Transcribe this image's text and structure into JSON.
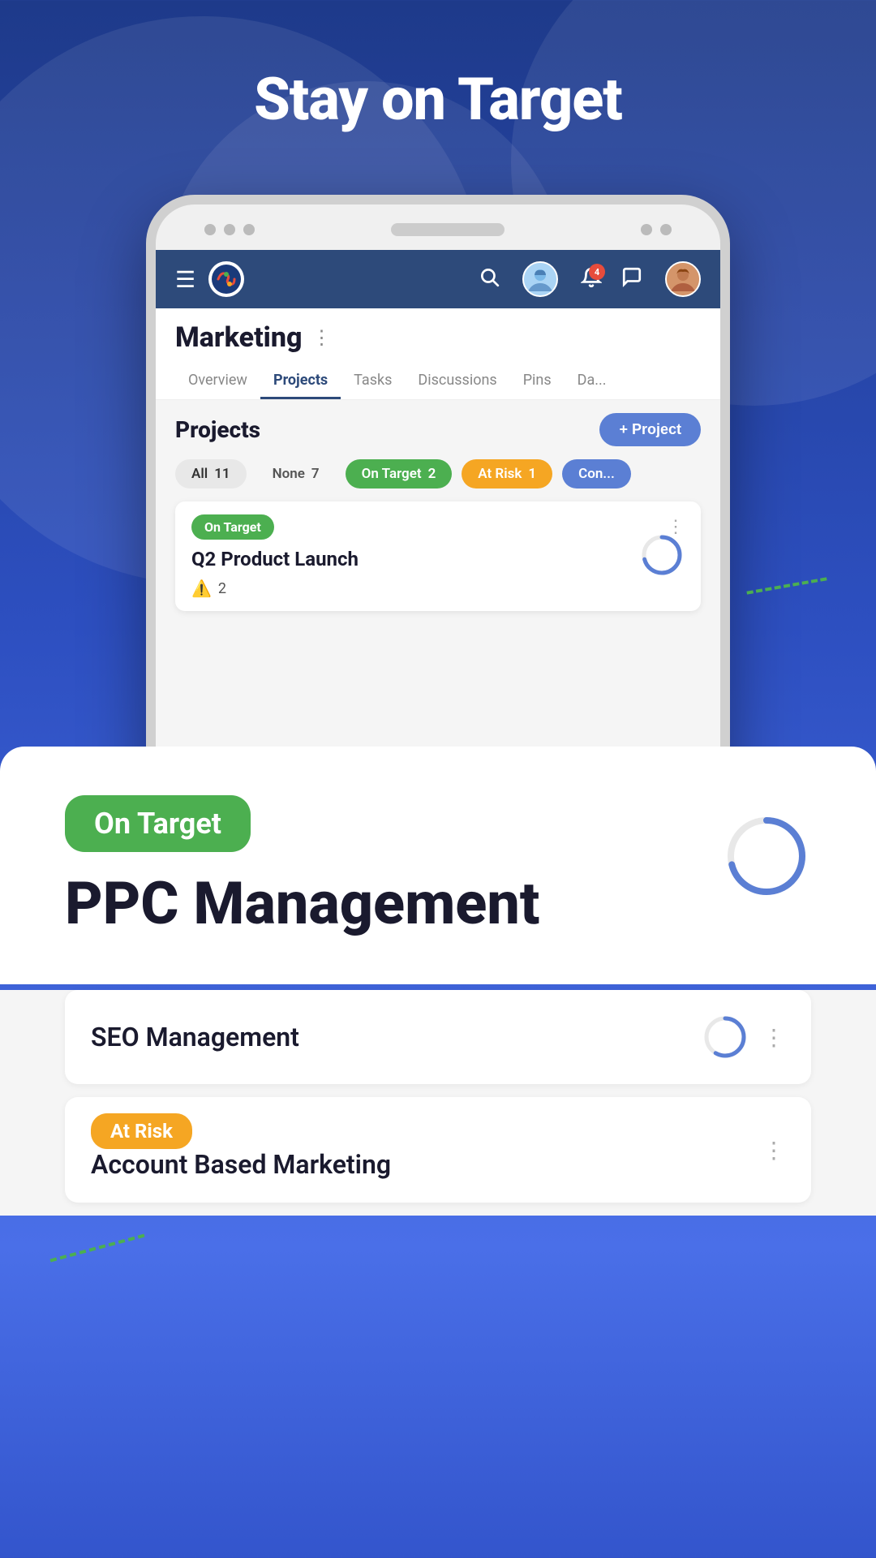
{
  "hero": {
    "title": "Stay on Target"
  },
  "app_header": {
    "title": "Marketing",
    "menu_label": "☰",
    "search_icon": "🔍",
    "notification_count": "4",
    "chat_icon": "💬"
  },
  "tabs": {
    "items": [
      {
        "label": "Overview",
        "active": false
      },
      {
        "label": "Projects",
        "active": true
      },
      {
        "label": "Tasks",
        "active": false
      },
      {
        "label": "Discussions",
        "active": false
      },
      {
        "label": "Pins",
        "active": false
      },
      {
        "label": "Da...",
        "active": false
      }
    ]
  },
  "projects_section": {
    "title": "Projects",
    "add_button": "+ Project",
    "filters": [
      {
        "label": "All",
        "count": "11",
        "type": "all"
      },
      {
        "label": "None",
        "count": "7",
        "type": "none"
      },
      {
        "label": "On Target",
        "count": "2",
        "type": "on-target"
      },
      {
        "label": "At Risk",
        "count": "1",
        "type": "at-risk"
      },
      {
        "label": "Con...",
        "count": "",
        "type": "more"
      }
    ]
  },
  "project_cards": [
    {
      "status": "On Target",
      "status_type": "on-target",
      "title": "Q2 Product Launch",
      "warning_count": "2"
    },
    {
      "status": "On Target",
      "status_type": "on-target",
      "title": "PPC Management"
    }
  ],
  "lower_section": {
    "status_badge": "On Target",
    "title": "PPC Management"
  },
  "list_items": [
    {
      "title": "SEO Management",
      "status": null
    },
    {
      "title": "Account Based Marketing",
      "status": "At Risk"
    }
  ],
  "colors": {
    "on_target": "#4caf50",
    "at_risk": "#f5a623",
    "primary_blue": "#2d4a7a",
    "accent_blue": "#5b7fd4",
    "progress_blue": "#5b7fd4"
  }
}
